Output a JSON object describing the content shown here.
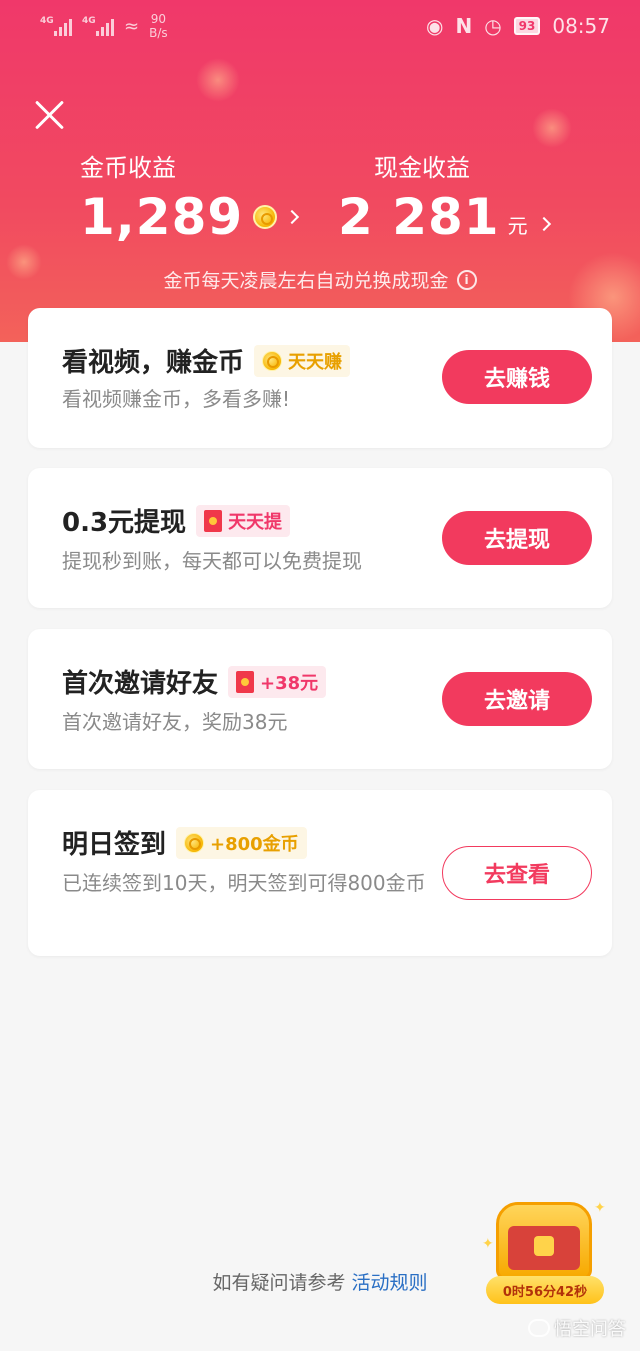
{
  "status_bar": {
    "net1": "4G",
    "net2": "4G",
    "speed_value": "90",
    "speed_unit": "B/s",
    "battery": "93",
    "time": "08:57"
  },
  "earnings": {
    "coin_label": "金币收益",
    "coin_value": "1,289",
    "cash_label": "现金收益",
    "cash_value": "2 281",
    "cash_unit": "元",
    "note": "金币每天凌晨左右自动兑换成现金"
  },
  "tasks": [
    {
      "title": "看视频，赚金币",
      "tag": "天天赚",
      "subtitle": "看视频赚金币，多看多赚!",
      "button": "去赚钱"
    },
    {
      "title": "0.3元提现",
      "tag": "天天提",
      "subtitle": "提现秒到账，每天都可以免费提现",
      "button": "去提现"
    },
    {
      "title": "首次邀请好友",
      "tag": "+38元",
      "subtitle": "首次邀请好友，奖励38元",
      "button": "去邀请"
    },
    {
      "title": "明日签到",
      "tag": "+800金币",
      "subtitle": "已连续签到10天，明天签到可得800金币",
      "button": "去查看"
    }
  ],
  "footer": {
    "text": "如有疑问请参考",
    "link": "活动规则"
  },
  "chest": {
    "timer": "0时56分42秒"
  },
  "watermark": "悟空问答",
  "colors": {
    "brand": "#f23a5e",
    "header_top": "#f0386a",
    "gold": "#e8a000"
  }
}
